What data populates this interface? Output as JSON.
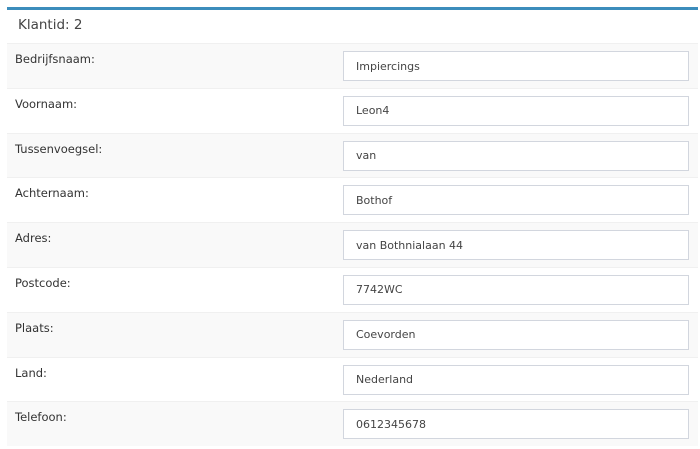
{
  "panel": {
    "title": "Klantid: 2",
    "accent_color": "#3c8dbc"
  },
  "fields": [
    {
      "label": "Bedrijfsnaam:",
      "value": "Impiercings"
    },
    {
      "label": "Voornaam:",
      "value": "Leon4"
    },
    {
      "label": "Tussenvoegsel:",
      "value": "van"
    },
    {
      "label": "Achternaam:",
      "value": "Bothof"
    },
    {
      "label": "Adres:",
      "value": "van Bothnialaan 44"
    },
    {
      "label": "Postcode:",
      "value": "7742WC"
    },
    {
      "label": "Plaats:",
      "value": "Coevorden"
    },
    {
      "label": "Land:",
      "value": "Nederland"
    },
    {
      "label": "Telefoon:",
      "value": "0612345678"
    }
  ]
}
